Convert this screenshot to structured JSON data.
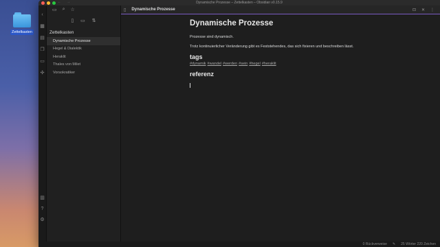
{
  "desktop": {
    "folder_label": "Zettelkasten"
  },
  "window": {
    "title": "Dynamische Prozesse – Zettelkasten – Obsidian v0.15.9"
  },
  "colors": {
    "close": "#ff5f57",
    "minimize": "#febc2e",
    "maximize": "#28c840",
    "accent": "#7a5cc4"
  },
  "sidebar": {
    "vault_name": "Zettelkasten",
    "files": [
      {
        "label": "Dynamische Prozesse",
        "active": true
      },
      {
        "label": "Hegel & Dialektik",
        "active": false
      },
      {
        "label": "Heraklit",
        "active": false
      },
      {
        "label": "Thales von Milet",
        "active": false
      },
      {
        "label": "Vorsokratiker",
        "active": false
      }
    ]
  },
  "tab": {
    "title": "Dynamische Prozesse"
  },
  "note": {
    "title": "Dynamische Prozesse",
    "para1": "Prozesse sind dynamisch.",
    "para2": "Trotz kontinuierlicher Veränderung gibt es Feststehendes, das sich fixieren und beschreiben lässt.",
    "heading_tags": "tags",
    "tags": [
      "#dynamik",
      "#wandel",
      "#werden",
      "#sein",
      "#hegel",
      "#heraklit"
    ],
    "heading_ref": "referenz"
  },
  "status": {
    "backlinks": "0 Rückverweise",
    "counts": "25 Wörter 220 Zeichen"
  },
  "icons": [
    "folder-icon",
    "search-icon",
    "star-icon",
    "new-note-icon",
    "new-folder-icon",
    "sort-icon",
    "file-icon",
    "reading-view-icon",
    "close-icon",
    "more-icon",
    "edit-icon"
  ]
}
